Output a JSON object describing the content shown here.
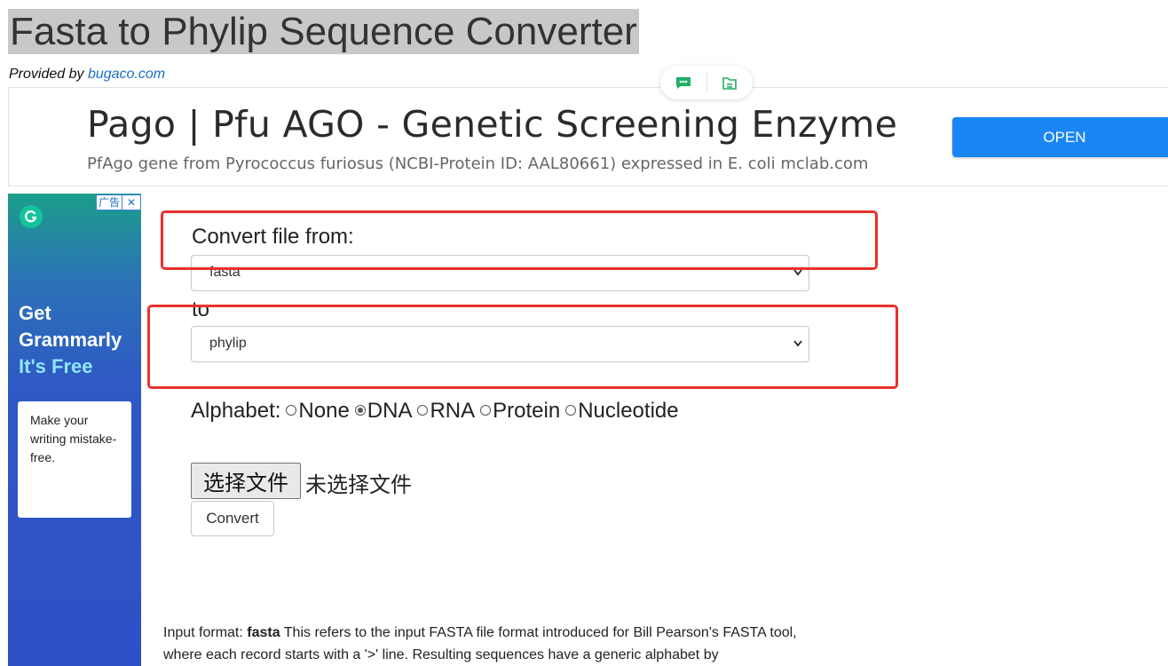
{
  "page": {
    "title": "Fasta to Phylip Sequence Converter",
    "provided_by_prefix": "Provided by ",
    "provided_by_link": "bugaco.com"
  },
  "top_ad": {
    "headline": "Pago | Pfu AGO - Genetic Screening Enzyme",
    "subtext": "PfAgo gene from Pyrococcus furiosus (NCBI-Protein ID: AAL80661) expressed in E. coli mclab.com",
    "open_label": "OPEN",
    "icons": [
      "chat-feedback-icon",
      "save-document-icon"
    ]
  },
  "side_ad": {
    "badge_label": "广告",
    "close_label": "✕",
    "get": "Get",
    "brand": "Grammarly",
    "free": "It's Free",
    "card_text": "Make your writing mistake-free."
  },
  "form": {
    "convert_from_label": "Convert file from:",
    "from_value": "fasta",
    "to_label": "to",
    "to_value": "phylip",
    "alphabet_label": "Alphabet:",
    "alphabet_options": [
      "None",
      "DNA",
      "RNA",
      "Protein",
      "Nucleotide"
    ],
    "alphabet_selected": "DNA",
    "file_button_label": "选择文件",
    "file_status": "未选择文件",
    "convert_label": "Convert"
  },
  "description": {
    "prefix": "Input format: ",
    "format_name": "fasta",
    "text": " This refers to the input FASTA file format introduced for Bill Pearson's FASTA tool, where each record starts with a '>' line. Resulting sequences have a generic alphabet by"
  },
  "colors": {
    "highlight_red": "#e8322c",
    "open_blue": "#1a86f5",
    "link_blue": "#1a6fc4",
    "grammarly_green": "#15c39a"
  }
}
